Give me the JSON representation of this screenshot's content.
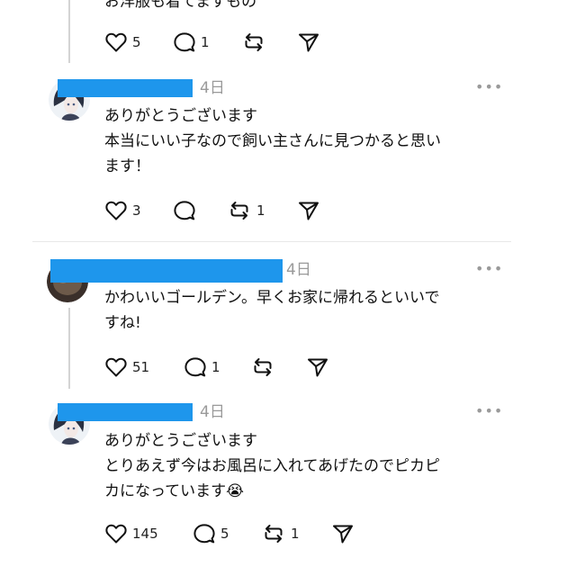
{
  "top_post": {
    "partial_text": "お洋服も着てますもの",
    "likes": "5",
    "replies": "1",
    "reposts": ""
  },
  "posts": [
    {
      "time": "4日",
      "text_lines": [
        "ありがとうございます",
        "本当にいい子なので飼い主さんに見つかると思い",
        "ます！"
      ],
      "likes": "3",
      "replies": "",
      "reposts": "1"
    },
    {
      "time": "4日",
      "text_lines": [
        "かわいいゴールデン。早くお家に帰れるといいで",
        "すね!"
      ],
      "likes": "51",
      "replies": "1",
      "reposts": ""
    },
    {
      "time": "4日",
      "text_lines": [
        "ありがとうございます",
        "とりあえず今はお風呂に入れてあげたのでピカピ",
        "カになっています😭"
      ],
      "likes": "145",
      "replies": "5",
      "reposts": "1"
    }
  ],
  "more_menu_glyph": "•••",
  "colors": {
    "redaction": "#1e96ec",
    "muted": "#9a9a9a",
    "thread_line": "#d4d4d4"
  },
  "icons": [
    "heart-icon",
    "comment-icon",
    "repost-icon",
    "share-icon",
    "more-icon"
  ]
}
